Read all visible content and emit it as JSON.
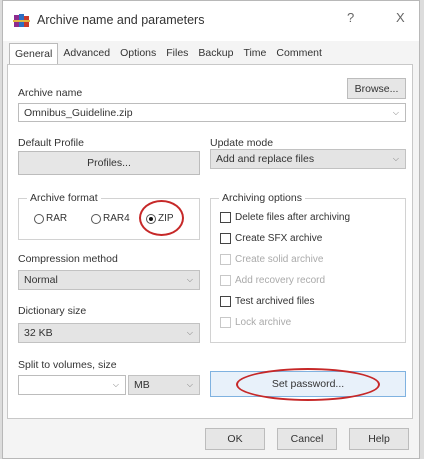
{
  "window": {
    "title": "Archive name and parameters",
    "help_glyph": "?",
    "close_glyph": "X"
  },
  "tabs": [
    {
      "label": "General",
      "active": true
    },
    {
      "label": "Advanced",
      "active": false
    },
    {
      "label": "Options",
      "active": false
    },
    {
      "label": "Files",
      "active": false
    },
    {
      "label": "Backup",
      "active": false
    },
    {
      "label": "Time",
      "active": false
    },
    {
      "label": "Comment",
      "active": false
    }
  ],
  "archive_name": {
    "label": "Archive name",
    "browse_label": "Browse...",
    "value": "Omnibus_Guideline.zip"
  },
  "default_profile": {
    "label": "Default Profile",
    "button_label": "Profiles..."
  },
  "update_mode": {
    "label": "Update mode",
    "value": "Add and replace files"
  },
  "archive_format": {
    "label": "Archive format",
    "options": [
      {
        "label": "RAR",
        "selected": false
      },
      {
        "label": "RAR4",
        "selected": false
      },
      {
        "label": "ZIP",
        "selected": true
      }
    ]
  },
  "compression": {
    "label": "Compression method",
    "value": "Normal"
  },
  "dictionary": {
    "label": "Dictionary size",
    "value": "32 KB"
  },
  "split": {
    "label": "Split to volumes, size",
    "value": "",
    "unit": "MB"
  },
  "archiving_options": {
    "label": "Archiving options",
    "items": [
      {
        "label": "Delete files after archiving",
        "enabled": true
      },
      {
        "label": "Create SFX archive",
        "enabled": true
      },
      {
        "label": "Create solid archive",
        "enabled": false
      },
      {
        "label": "Add recovery record",
        "enabled": false
      },
      {
        "label": "Test archived files",
        "enabled": true
      },
      {
        "label": "Lock archive",
        "enabled": false
      }
    ]
  },
  "set_password_label": "Set password...",
  "footer": {
    "ok": "OK",
    "cancel": "Cancel",
    "help": "Help"
  },
  "colors": {
    "highlight_ring": "#c62828",
    "set_password_bg": "#e8f1fa",
    "set_password_border": "#7fb2e0"
  }
}
